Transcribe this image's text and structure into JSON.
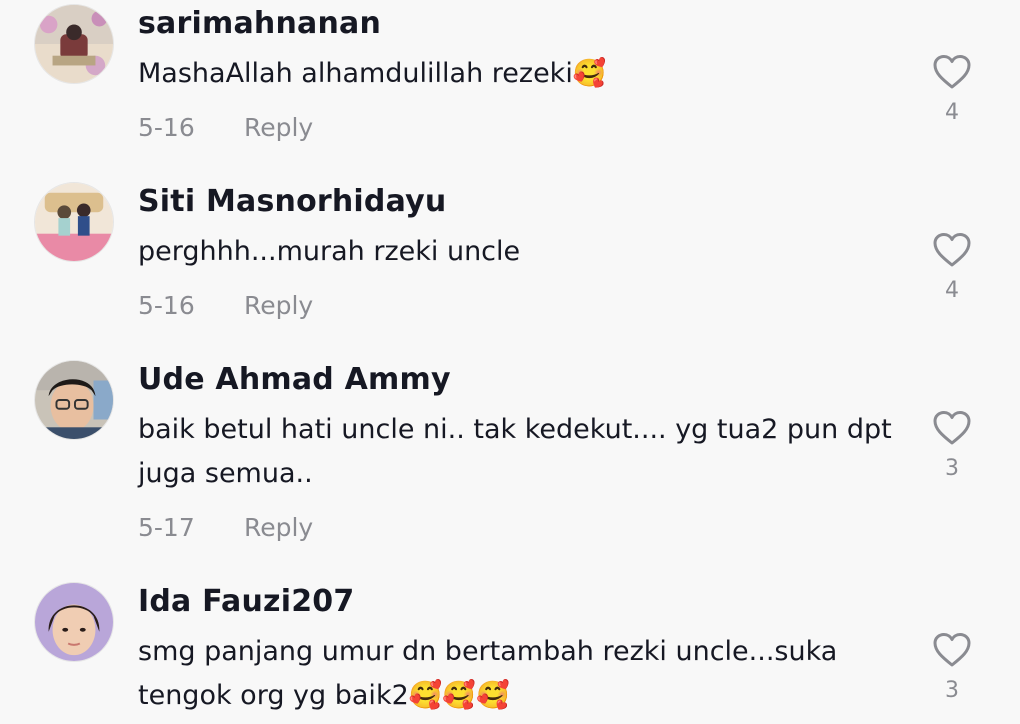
{
  "comments": [
    {
      "username": "sarimahnanan",
      "text": "MashaAllah alhamdulillah rezeki🥰",
      "date": "5-16",
      "reply_label": "Reply",
      "likes": "4"
    },
    {
      "username": "Siti Masnorhidayu",
      "text": "perghhh...murah rzeki uncle",
      "date": "5-16",
      "reply_label": "Reply",
      "likes": "4"
    },
    {
      "username": "Ude Ahmad Ammy",
      "text": "baik betul hati uncle ni.. tak kedekut.... yg tua2 pun dpt juga semua..",
      "date": "5-17",
      "reply_label": "Reply",
      "likes": "3"
    },
    {
      "username": "Ida Fauzi207",
      "text": "smg panjang umur dn bertambah rezki uncle...suka tengok org yg baik2🥰🥰🥰",
      "likes": "3"
    }
  ],
  "colors": {
    "background": "#f8f8f8",
    "username": "#161823",
    "meta": "#8a8b91",
    "icon_stroke": "#8a8b91"
  },
  "icons": {
    "like": "heart-outline-icon"
  }
}
